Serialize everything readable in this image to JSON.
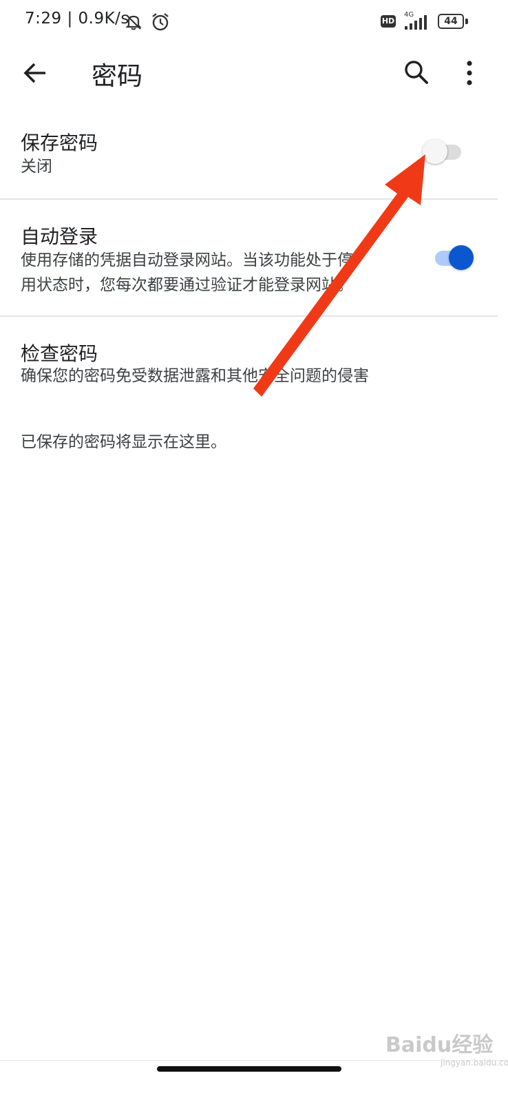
{
  "status_bar": {
    "time_speed": "7:29 | 0.9K/s",
    "hd_badge": "HD",
    "network": "4G",
    "battery": "44"
  },
  "app_bar": {
    "title": "密码"
  },
  "settings": {
    "save_passwords": {
      "title": "保存密码",
      "summary": "关闭",
      "enabled": false
    },
    "auto_signin": {
      "title": "自动登录",
      "summary_line1": "使用存储的凭据自动登录网站。当该功能处于停",
      "summary_line2": "用状态时，您每次都要通过验证才能登录网站。",
      "enabled": true
    },
    "check_passwords": {
      "title": "检查密码",
      "summary": "确保您的密码免受数据泄露和其他安全问题的侵害"
    }
  },
  "empty_state": "已保存的密码将显示在这里。",
  "watermark": {
    "text": "Baidu经验",
    "sub": "jingyan.baidu.com"
  },
  "colors": {
    "accent": "#0b57d0",
    "annotation_arrow": "#f03a17"
  }
}
